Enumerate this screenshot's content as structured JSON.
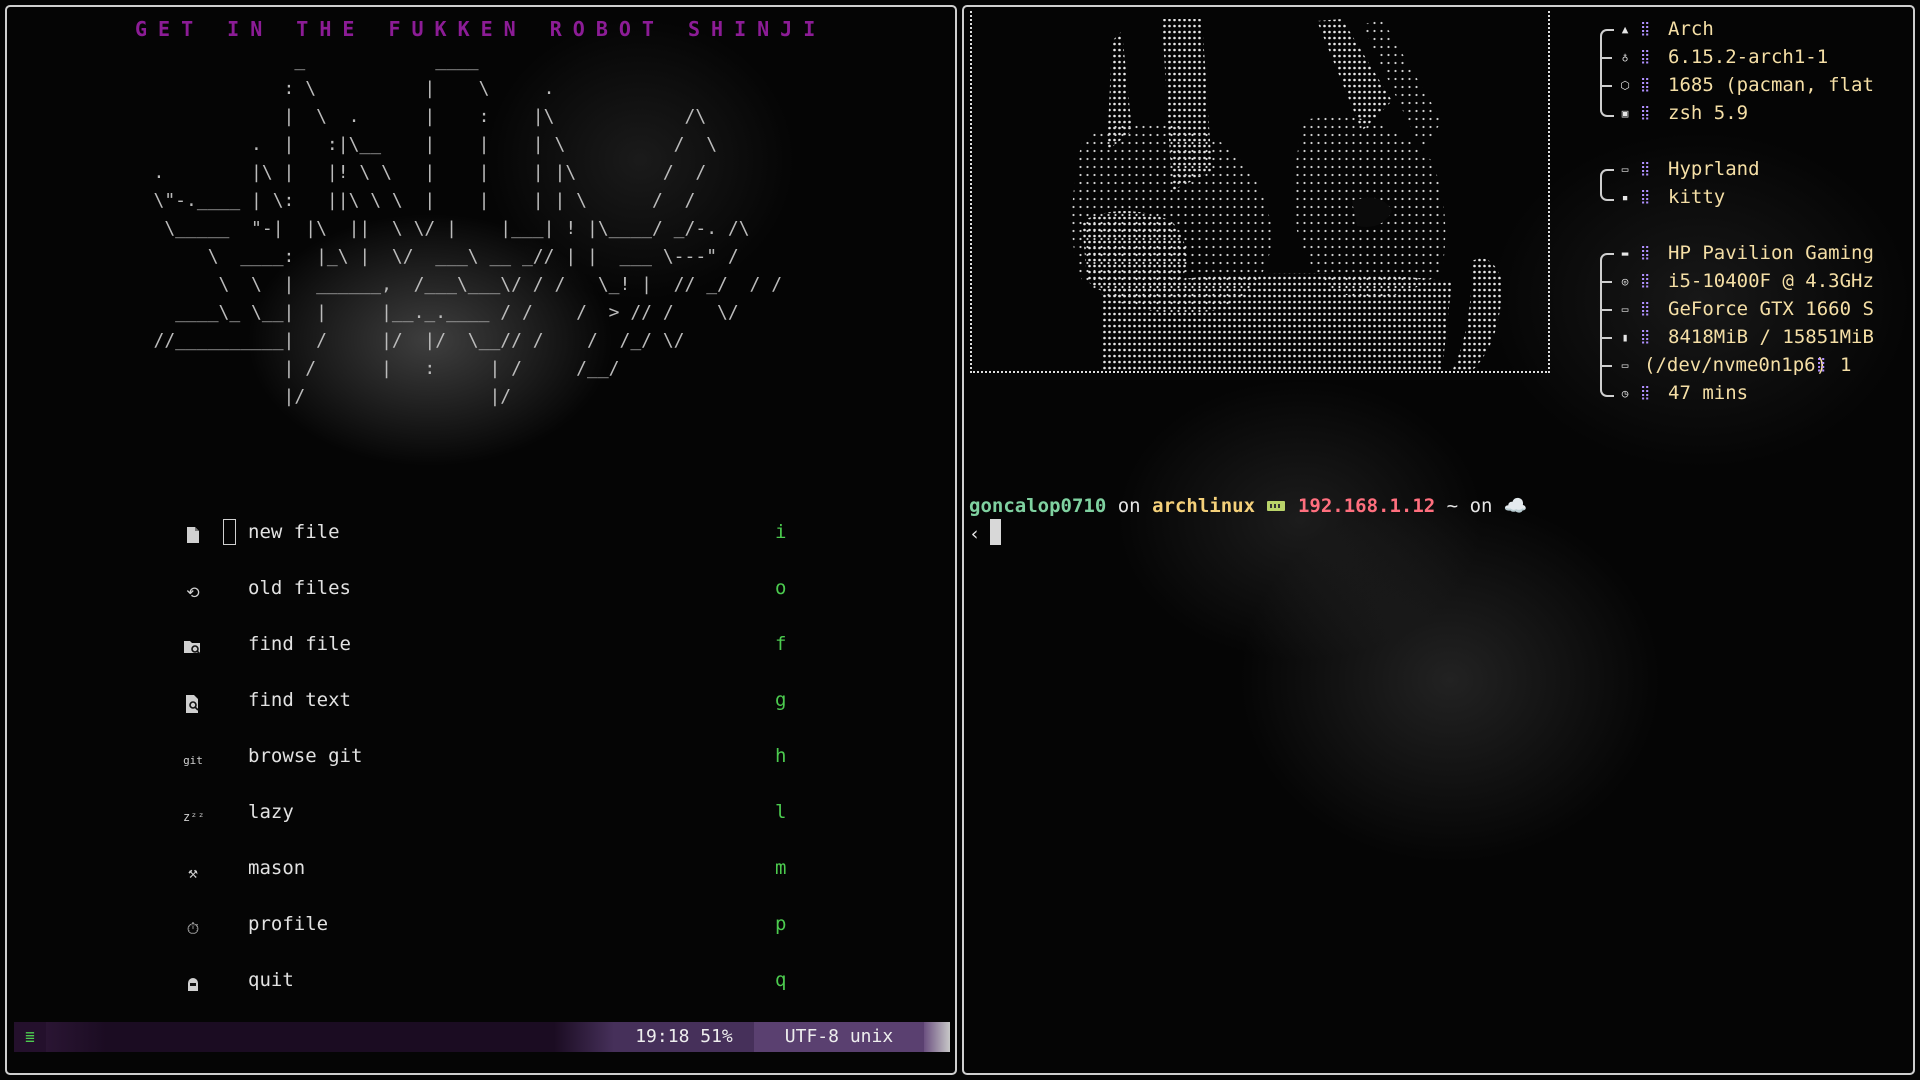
{
  "nvim": {
    "banner": "GET IN THE FUKKEN ROBOT SHINJI",
    "menu": [
      {
        "icon": "new-file-icon",
        "label": "new file",
        "key": "i"
      },
      {
        "icon": "old-files-icon",
        "label": "old files",
        "key": "o"
      },
      {
        "icon": "find-file-icon",
        "label": "find file",
        "key": "f"
      },
      {
        "icon": "find-text-icon",
        "label": "find text",
        "key": "g"
      },
      {
        "icon": "git-icon",
        "label": "browse git",
        "key": "h"
      },
      {
        "icon": "sleep-icon",
        "label": "lazy",
        "key": "l"
      },
      {
        "icon": "tools-icon",
        "label": "mason",
        "key": "m"
      },
      {
        "icon": "stopwatch-icon",
        "label": "profile",
        "key": "p"
      },
      {
        "icon": "quit-icon",
        "label": "quit",
        "key": "q"
      }
    ],
    "status": {
      "mode_icon": "menu-icon",
      "time": "19:18",
      "percent": "51%",
      "encoding": "UTF-8",
      "fileformat": "unix"
    }
  },
  "fetch": {
    "os": "Arch",
    "kernel": "6.15.2-arch1-1",
    "packages": "1685 (pacman, flat",
    "shell": "zsh 5.9",
    "wm": "Hyprland",
    "terminal": "kitty",
    "host": "HP Pavilion Gaming",
    "cpu": "i5-10400F @ 4.3GHz",
    "gpu": "GeForce GTX 1660 S",
    "memory": "8418MiB / 15851MiB",
    "disk": "(/dev/nvme0n1p6)",
    "disk_extra": "1",
    "uptime": "47 mins",
    "colors": {
      "dots": "#b090ff",
      "values": "#f5dfa6"
    }
  },
  "prompt": {
    "user": "goncalop0710",
    "on1": "on",
    "host": "archlinux",
    "ip": "192.168.1.12",
    "dir": "~",
    "on2": "on",
    "cloud": "☁️",
    "caret": "‹"
  },
  "colors": {
    "green": "#4ccb4f",
    "purple": "#9c28b4",
    "banner": "#8c1c96",
    "statusbar": "#1b0c22"
  }
}
